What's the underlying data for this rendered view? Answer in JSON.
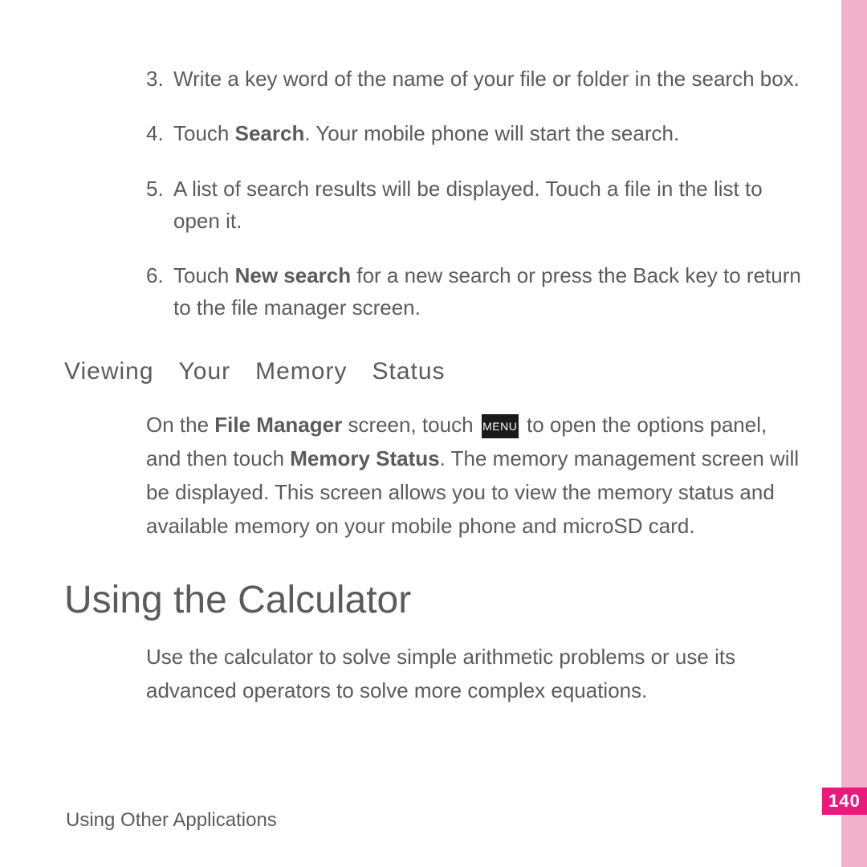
{
  "steps": {
    "s3": {
      "num": "3.",
      "text": "Write a key word of the name of your file or folder in the search box."
    },
    "s4": {
      "num": "4.",
      "prefix": "Touch ",
      "bold": "Search",
      "suffix": ". Your mobile phone will start the search."
    },
    "s5": {
      "num": "5.",
      "text": "A list of search results will be displayed. Touch a file in the list to open it."
    },
    "s6": {
      "num": "6.",
      "prefix": "Touch ",
      "bold": "New search",
      "suffix": " for a new search or press the Back key to return to the file manager screen."
    }
  },
  "section": {
    "title": "Viewing Your Memory Status",
    "p1a": "On the ",
    "p1b": "File Manager",
    "p1c": " screen, touch ",
    "menu": "MENU",
    "p1d": " to open the options panel, and then touch ",
    "p1e": "Memory Status",
    "p1f": ". The memory management screen will be displayed. This screen allows you to view the memory status and available memory on your mobile phone and microSD card."
  },
  "main": {
    "title": "Using the Calculator",
    "para": "Use the calculator to solve simple arithmetic problems or use its advanced operators to solve more complex equations."
  },
  "footer": "Using Other Applications",
  "pageNumber": "140"
}
